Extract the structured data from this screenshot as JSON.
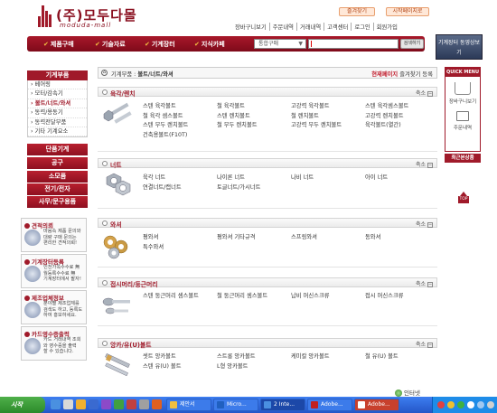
{
  "header": {
    "logo_text": "(주)모두다몰",
    "logo_sub": "moduda-mall",
    "bookmark_button": "즐겨찾기",
    "homepage_button": "시작페이지로",
    "links": [
      "장바구니보기",
      "주문내역",
      "거래내역",
      "고객센터",
      "로그인",
      "회원가입"
    ]
  },
  "mainnav": {
    "items": [
      "제품구매",
      "기술자료",
      "기계장터",
      "지식카페"
    ],
    "search_select": "통합구매",
    "search_button": "검색하기"
  },
  "sidebar_right": {
    "promo_label": "기계장터 동영상보기",
    "quick_title": "QUICK MENU",
    "quick_cart": "장바구니보기",
    "quick_order": "주문내역",
    "top_label": "TOP",
    "recent_title": "최근본상품"
  },
  "categories": {
    "title": "기계부품",
    "items": [
      "베어링",
      "모터/감속기",
      "볼트/너트/와셔",
      "동력/용동기",
      "동력전달부품",
      "기타 기계요소"
    ],
    "active_index": 2,
    "buttons": [
      "단품기계",
      "공구",
      "소모품",
      "전기/전자",
      "사무/문구용품"
    ]
  },
  "promos": [
    {
      "title": "견적의뢰",
      "lines": [
        "마음속 제품 문의와",
        "대량 구매 문의는",
        "편리한 견적의뢰!"
      ]
    },
    {
      "title": "기계장터등록",
      "lines": [
        "인천가쪽수수료 無",
        "월등록수수료 無",
        "기계장터에서 팔자!"
      ]
    },
    {
      "title": "제조업체정보",
      "lines": [
        "분야별 제조업체를",
        "검색도 하고, 등록도",
        "하여 홍보하세요."
      ]
    },
    {
      "title": "카드영수증출력",
      "lines": [
        "카드 거래내역 조회",
        "와 영수증을 출력",
        "할 수 있습니다."
      ]
    }
  ],
  "breadcrumb": {
    "prefix": "기계부품 :",
    "path": "볼트/너트/와셔",
    "bookmark_prefix": "현재페이지",
    "bookmark_label": "즐겨찾기 등록"
  },
  "fold_label": "축소",
  "sections": [
    {
      "title": "육각/렌치",
      "items": [
        "스텐 육각볼트",
        "철 육각볼트",
        "고강력 육각볼트",
        "스텐 육각셈스볼트",
        "철 육각 셈스볼트",
        "스텐 렌치볼트",
        "철 렌치볼트",
        "고강력 렌치볼트",
        "스텐 무두 렌치볼트",
        "철 무두 렌치볼트",
        "고강력 무두 렌치볼트",
        "육각볼트(열간)",
        "건축용볼트(F10T)"
      ]
    },
    {
      "title": "너트",
      "items": [
        "육각 너트",
        "나이론 너트",
        "나비 너트",
        "아이 너트",
        "연결너트/캡너트",
        "토글너트/가시너트"
      ]
    },
    {
      "title": "와셔",
      "items": [
        "평와셔",
        "평와셔 기타규격",
        "스프링와셔",
        "동와셔",
        "특수와셔"
      ]
    },
    {
      "title": "접시머리/둥근머리",
      "items": [
        "스텐 둥근머리 셈스볼트",
        "철 둥근머리 셈스볼트",
        "납비 머신스크류",
        "접시 머신스크류"
      ]
    },
    {
      "title": "앙카/유(U)볼트",
      "items": [
        "셋트 앙카볼트",
        "스트롱 앙카볼트",
        "케미칼 앙카볼트",
        "철 유(U) 볼트",
        "스텐 유(U) 볼트",
        "L형 앙카볼트"
      ]
    }
  ],
  "statusbar": {
    "zone": "인터넷"
  },
  "taskbar": {
    "start": "시작",
    "tasks": [
      "제안서",
      "Micro...",
      "2 Inte...",
      "Adobe...",
      "Adobe..."
    ],
    "active_task": 2
  }
}
